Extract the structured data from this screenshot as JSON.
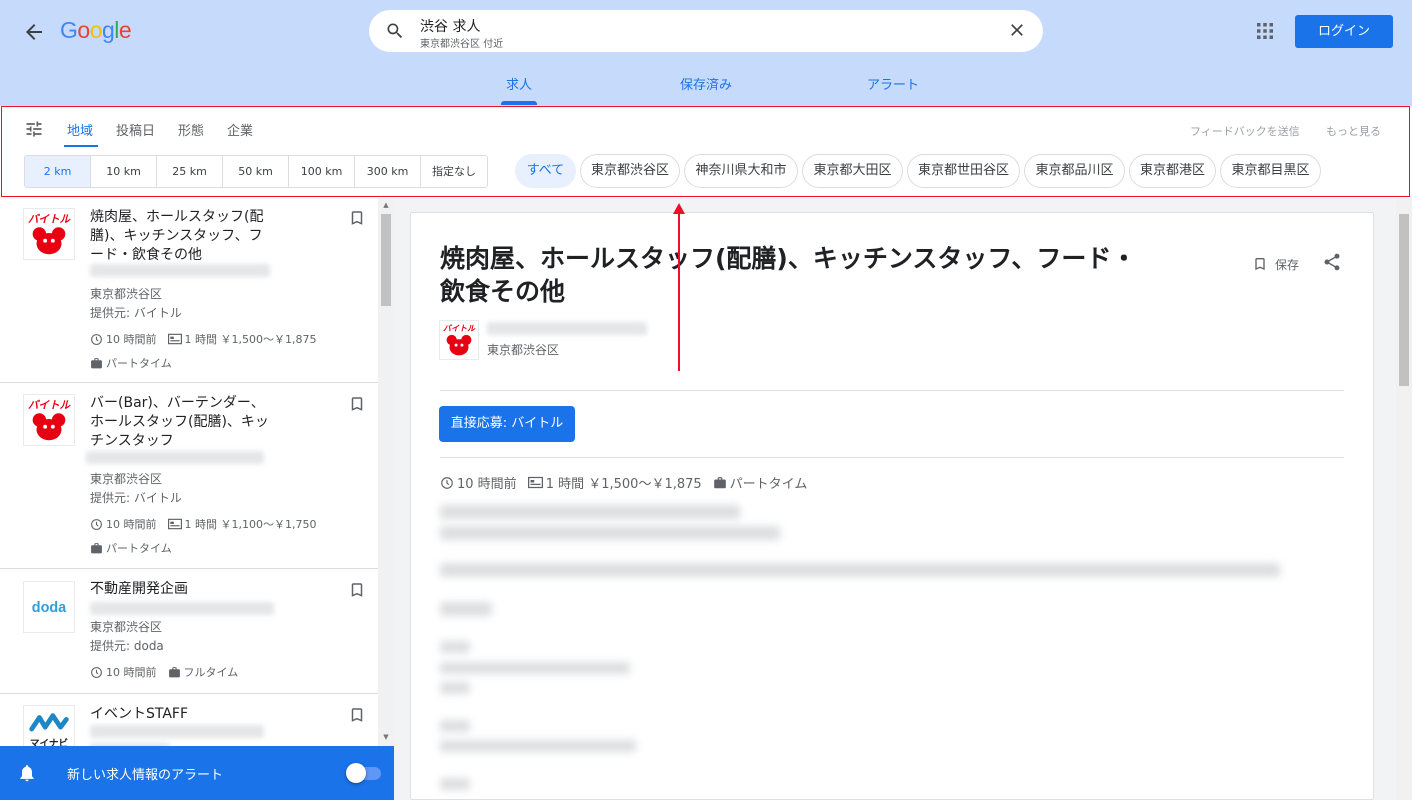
{
  "header": {
    "logo": "Google",
    "search_query": "渋谷 求人",
    "search_location": "東京都渋谷区 付近",
    "login_label": "ログイン",
    "tabs": [
      {
        "label": "求人"
      },
      {
        "label": "保存済み"
      },
      {
        "label": "アラート"
      }
    ]
  },
  "filters": {
    "tabs": [
      {
        "label": "地域"
      },
      {
        "label": "投稿日"
      },
      {
        "label": "形態"
      },
      {
        "label": "企業"
      }
    ],
    "feedback_label": "フィードバックを送信",
    "more_label": "もっと見る",
    "distances": [
      "2 km",
      "10 km",
      "25 km",
      "50 km",
      "100 km",
      "300 km",
      "指定なし"
    ],
    "selected_distance": "2 km",
    "locations": [
      "すべて",
      "東京都渋谷区",
      "神奈川県大和市",
      "東京都大田区",
      "東京都世田谷区",
      "東京都品川区",
      "東京都港区",
      "東京都目黒区"
    ],
    "selected_location": "すべて"
  },
  "jobs": [
    {
      "title": "焼肉屋、ホールスタッフ(配膳)、キッチンスタッフ、フード・飲食その他",
      "location": "東京都渋谷区",
      "source": "提供元: バイトル",
      "posted": "10 時間前",
      "hours": "1 時間 ￥1,500～￥1,875",
      "type": "パートタイム",
      "logo_text": "バイトル"
    },
    {
      "title": "バー(Bar)、バーテンダー、ホールスタッフ(配膳)、キッチンスタッフ",
      "location": "東京都渋谷区",
      "source": "提供元: バイトル",
      "posted": "10 時間前",
      "hours": "1 時間 ￥1,100～￥1,750",
      "type": "パートタイム",
      "logo_text": "バイトル"
    },
    {
      "title": "不動産開発企画",
      "location": "東京都渋谷区",
      "source": "提供元: doda",
      "posted": "10 時間前",
      "type": "フルタイム",
      "logo_text": "doda"
    },
    {
      "title": "イベントSTAFF",
      "logo_text": "マイナビ"
    }
  ],
  "alert": {
    "label": "新しい求人情報のアラート",
    "enabled": true
  },
  "detail": {
    "title": "焼肉屋、ホールスタッフ(配膳)、キッチンスタッフ、フード・飲食その他",
    "save_label": "保存",
    "location": "東京都渋谷区",
    "apply_label": "直接応募: バイトル",
    "posted": "10 時間前",
    "hours": "1 時間 ￥1,500～￥1,875",
    "type": "パートタイム"
  },
  "colors": {
    "header_bg": "#c6dafc",
    "accent": "#1a73e8",
    "highlight_box": "#e8132a"
  }
}
